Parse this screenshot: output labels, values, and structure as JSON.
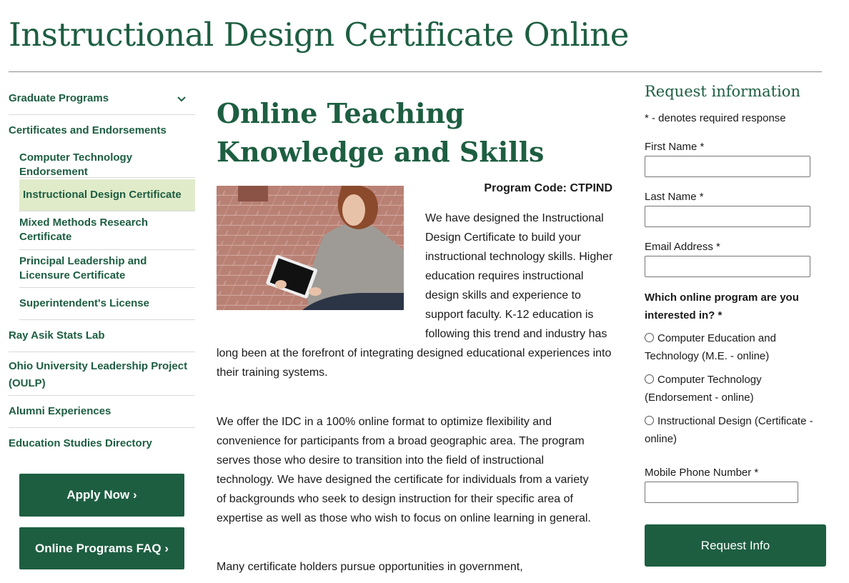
{
  "header": {
    "title": "Instructional Design Certificate Online"
  },
  "sidebar": {
    "graduate_programs": "Graduate Programs",
    "certificates": "Certificates and Endorsements",
    "sub_items": [
      "Computer Technology Endorsement",
      "Instructional Design Certificate",
      "Mixed Methods Research Certificate",
      "Principal Leadership and Licensure Certificate",
      "Superintendent's License"
    ],
    "stats_lab": "Ray Asik Stats Lab",
    "oulp": "Ohio University Leadership Project (OULP)",
    "alumni": "Alumni Experiences",
    "directory": "Education Studies Directory",
    "apply_button": "Apply Now ›",
    "faq_button": "Online Programs FAQ ›"
  },
  "main": {
    "heading": "Online Teaching Knowledge and Skills",
    "program_code": "Program Code: CTPIND",
    "para1": "We have designed the Instructional Design Certificate to build your instructional technology skills. Higher education requires instructional design skills and experience to support faculty. K-12 education is following this trend and industry has long been at the forefront of integrating designed educational experiences into their training systems.",
    "para2": "We offer the IDC in a 100% online format to optimize flexibility and convenience for participants from a broad geographic area. The program serves those who desire to transition into the field of instructional technology. We have designed the certificate for individuals from a variety of backgrounds who seek to design instruction for their specific area of expertise as well as those who wish to focus on online learning in general.",
    "para3": "Many certificate holders pursue opportunities in government,"
  },
  "form": {
    "title": "Request information",
    "required_note": "* - denotes required response",
    "first_name_label": "First Name *",
    "first_name_value": "",
    "last_name_label": "Last Name *",
    "last_name_value": "",
    "email_label": "Email Address *",
    "email_value": "",
    "program_question": "Which online program are you interested in? *",
    "options": [
      "Computer Education and Technology (M.E. - online)",
      "Computer Technology (Endorsement - online)",
      "Instructional Design (Certificate - online)"
    ],
    "phone_label": "Mobile Phone Number *",
    "phone_value": "",
    "submit": "Request Info"
  },
  "icons": {
    "nav_toggle": "chevron-down-icon"
  },
  "colors": {
    "brand_green": "#1d5e41",
    "active_bg": "#e0ebc9"
  }
}
